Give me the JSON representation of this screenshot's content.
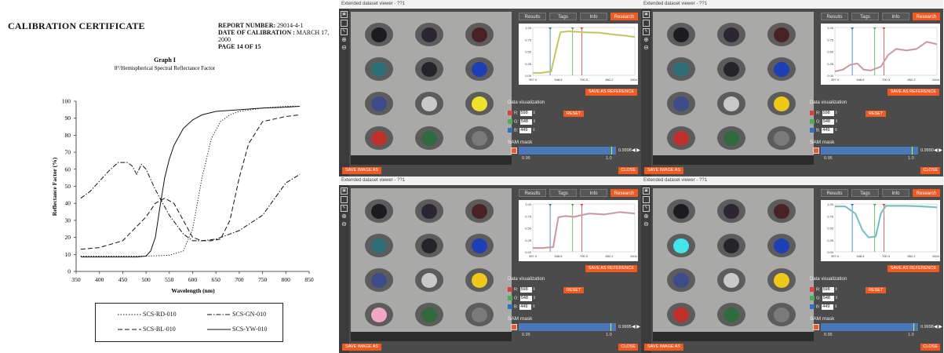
{
  "certificate": {
    "title": "CALIBRATION CERTIFICATE",
    "report_label": "REPORT NUMBER:",
    "report_value": "29014-4-1",
    "date_label": "DATE OF CALIBRATION :",
    "date_value": "MARCH 17, 2000",
    "page_text": "PAGE 14 OF  15",
    "legend": [
      "SCS-RD-010",
      "SCS-GN-010",
      "SCS-BL-010",
      "SCS-YW-010"
    ]
  },
  "chart_data": {
    "type": "line",
    "title": "Graph I",
    "subtitle": "8°/Hemispherical Spectral Reflectance Factor",
    "xlabel": "Wavelength (nm)",
    "ylabel": "Reflectance Factor (%)",
    "xlim": [
      350,
      850
    ],
    "ylim": [
      0,
      100
    ],
    "xticks": [
      350,
      400,
      450,
      500,
      550,
      600,
      650,
      700,
      750,
      800,
      850
    ],
    "yticks": [
      0,
      10,
      20,
      30,
      40,
      50,
      60,
      70,
      80,
      90,
      100
    ],
    "grid": false,
    "series": [
      {
        "name": "SCS-RD-010",
        "dash": "dotted",
        "x": [
          360,
          400,
          450,
          500,
          550,
          580,
          600,
          620,
          640,
          660,
          680,
          700,
          750,
          800,
          830
        ],
        "y": [
          9,
          9,
          9,
          9,
          9.5,
          12,
          25,
          55,
          78,
          88,
          92,
          94,
          96,
          97,
          97
        ]
      },
      {
        "name": "SCS-GN-010",
        "dash": "dashdot",
        "x": [
          360,
          380,
          400,
          420,
          440,
          460,
          470,
          480,
          490,
          500,
          520,
          550,
          580,
          600,
          620,
          650,
          680,
          700,
          750,
          800,
          830
        ],
        "y": [
          43,
          47,
          53,
          59,
          64,
          64,
          62,
          57,
          63,
          60,
          48,
          33,
          22,
          18,
          18,
          19,
          22,
          24,
          33,
          52,
          57
        ]
      },
      {
        "name": "SCS-BL-010",
        "dash": "dashed",
        "x": [
          360,
          400,
          450,
          500,
          520,
          540,
          560,
          580,
          600,
          620,
          640,
          660,
          680,
          700,
          720,
          750,
          800,
          830
        ],
        "y": [
          13,
          14,
          18,
          32,
          40,
          43,
          40,
          30,
          20,
          18,
          18,
          19,
          30,
          55,
          75,
          88,
          91,
          92
        ]
      },
      {
        "name": "SCS-YW-010",
        "dash": "solid",
        "x": [
          360,
          400,
          450,
          480,
          500,
          510,
          520,
          530,
          540,
          550,
          560,
          580,
          600,
          620,
          650,
          700,
          750,
          800,
          830
        ],
        "y": [
          8.5,
          8.5,
          8.5,
          8.5,
          9,
          12,
          20,
          38,
          55,
          66,
          74,
          84,
          89,
          92,
          94,
          95,
          96,
          96.5,
          97
        ]
      }
    ]
  },
  "viewers": [
    {
      "title": "Extended dataset viewer - ??1",
      "tabs": [
        "Results",
        "Tags",
        "Info",
        "Research"
      ],
      "active_tab": "Research",
      "spectrum": {
        "yticks": [
          "1.00",
          "0.75",
          "0.50",
          "0.25",
          "0.00"
        ],
        "xticks": [
          "397.0",
          "548.6",
          "700.3",
          "852.2",
          "1004.0"
        ],
        "curve_color": "#d6d86a"
      },
      "save_reference": "SAVE AS REFERENCE",
      "data_visualization": "Data visualization",
      "channels": [
        {
          "label": "R:",
          "value": "598",
          "color": "#e0403a"
        },
        {
          "label": "G:",
          "value": "548",
          "color": "#4caf50"
        },
        {
          "label": "B:",
          "value": "449",
          "color": "#2a73c9"
        }
      ],
      "reset": "RESET",
      "sam_label": "SAM mask",
      "sam_value": "0.9998",
      "sam_level": 0.9998,
      "sam_min": "0.95",
      "sam_max": "1.0",
      "save_image": "SAVE IMAGE AS",
      "close": "CLOSE",
      "discs": [
        "#1b1b20",
        "#2d2435",
        "#4a2226",
        "#2f6f79",
        "#26242a",
        "#1d3fb8",
        "#3d4b88",
        "#c9c9c9",
        "#f0e22a",
        "#c0302a",
        "#2f6b3b",
        "#7a7a7a"
      ]
    },
    {
      "title": "Extended dataset viewer - ??1",
      "tabs": [
        "Results",
        "Tags",
        "Info",
        "Research"
      ],
      "active_tab": "Research",
      "spectrum": {
        "yticks": [
          "1.00",
          "0.75",
          "0.50",
          "0.25",
          "0.00"
        ],
        "xticks": [
          "397.0",
          "548.6",
          "700.3",
          "852.2",
          "1004.0"
        ],
        "curve_color": "#d8a7ad"
      },
      "save_reference": "SAVE AS REFERENCE",
      "data_visualization": "Data visualization",
      "channels": [
        {
          "label": "R:",
          "value": "598",
          "color": "#e0403a"
        },
        {
          "label": "G:",
          "value": "548",
          "color": "#4caf50"
        },
        {
          "label": "B:",
          "value": "449",
          "color": "#2a73c9"
        }
      ],
      "reset": "RESET",
      "sam_label": "SAM mask",
      "sam_value": "0.9990",
      "sam_level": 0.999,
      "sam_min": "0.95",
      "sam_max": "1.0",
      "save_image": "SAVE IMAGE AS",
      "close": "CLOSE",
      "discs": [
        "#1b1b20",
        "#2d2435",
        "#4a2226",
        "#2f6f79",
        "#26242a",
        "#1d3fb8",
        "#3d4b88",
        "#c9c9c9",
        "#f0c81a",
        "#c0302a",
        "#2f6b3b",
        "#7a7a7a"
      ]
    },
    {
      "title": "Extended dataset viewer - ??1",
      "tabs": [
        "Results",
        "Tags",
        "Info",
        "Research"
      ],
      "active_tab": "Research",
      "spectrum": {
        "yticks": [
          "1.00",
          "0.75",
          "0.50",
          "0.25",
          "0.00"
        ],
        "xticks": [
          "397.0",
          "548.6",
          "700.3",
          "852.2",
          "1004.0"
        ],
        "curve_color": "#d8a7ad"
      },
      "save_reference": "SAVE AS REFERENCE",
      "data_visualization": "Data visualization",
      "channels": [
        {
          "label": "R:",
          "value": "598",
          "color": "#e0403a"
        },
        {
          "label": "G:",
          "value": "548",
          "color": "#4caf50"
        },
        {
          "label": "B:",
          "value": "449",
          "color": "#2a73c9"
        }
      ],
      "reset": "RESET",
      "sam_label": "SAM mask",
      "sam_value": "0.9995",
      "sam_level": 0.9995,
      "sam_min": "0.95",
      "sam_max": "1.0",
      "save_image": "SAVE IMAGE AS",
      "close": "CLOSE",
      "discs": [
        "#1b1b20",
        "#2d2435",
        "#4a2226",
        "#2f6f79",
        "#26242a",
        "#1d3fb8",
        "#3d4b88",
        "#c9c9c9",
        "#f0c81a",
        "#f2a6c6",
        "#2f6b3b",
        "#7a7a7a"
      ]
    },
    {
      "title": "Extended dataset viewer - ??1",
      "tabs": [
        "Results",
        "Tags",
        "Info",
        "Research"
      ],
      "active_tab": "Research",
      "spectrum": {
        "yticks": [
          "1.00",
          "0.75",
          "0.50",
          "0.25",
          "0.00"
        ],
        "xticks": [
          "397.0",
          "548.6",
          "700.3",
          "852.2",
          "1004.0"
        ],
        "curve_color": "#7ccfcf"
      },
      "save_reference": "SAVE AS REFERENCE",
      "data_visualization": "Data visualization",
      "channels": [
        {
          "label": "R:",
          "value": "598",
          "color": "#e0403a"
        },
        {
          "label": "G:",
          "value": "548",
          "color": "#4caf50"
        },
        {
          "label": "B:",
          "value": "449",
          "color": "#2a73c9"
        }
      ],
      "reset": "RESET",
      "sam_label": "SAM mask",
      "sam_value": "0.9998",
      "sam_level": 0.9998,
      "sam_min": "0.95",
      "sam_max": "1.0",
      "save_image": "SAVE IMAGE AS",
      "close": "CLOSE",
      "discs": [
        "#1b1b20",
        "#2d2435",
        "#4a2226",
        "#40e6ec",
        "#26242a",
        "#1d3fb8",
        "#3d4b88",
        "#c9c9c9",
        "#f0c81a",
        "#c0302a",
        "#2f6b3b",
        "#7a7a7a"
      ]
    }
  ]
}
